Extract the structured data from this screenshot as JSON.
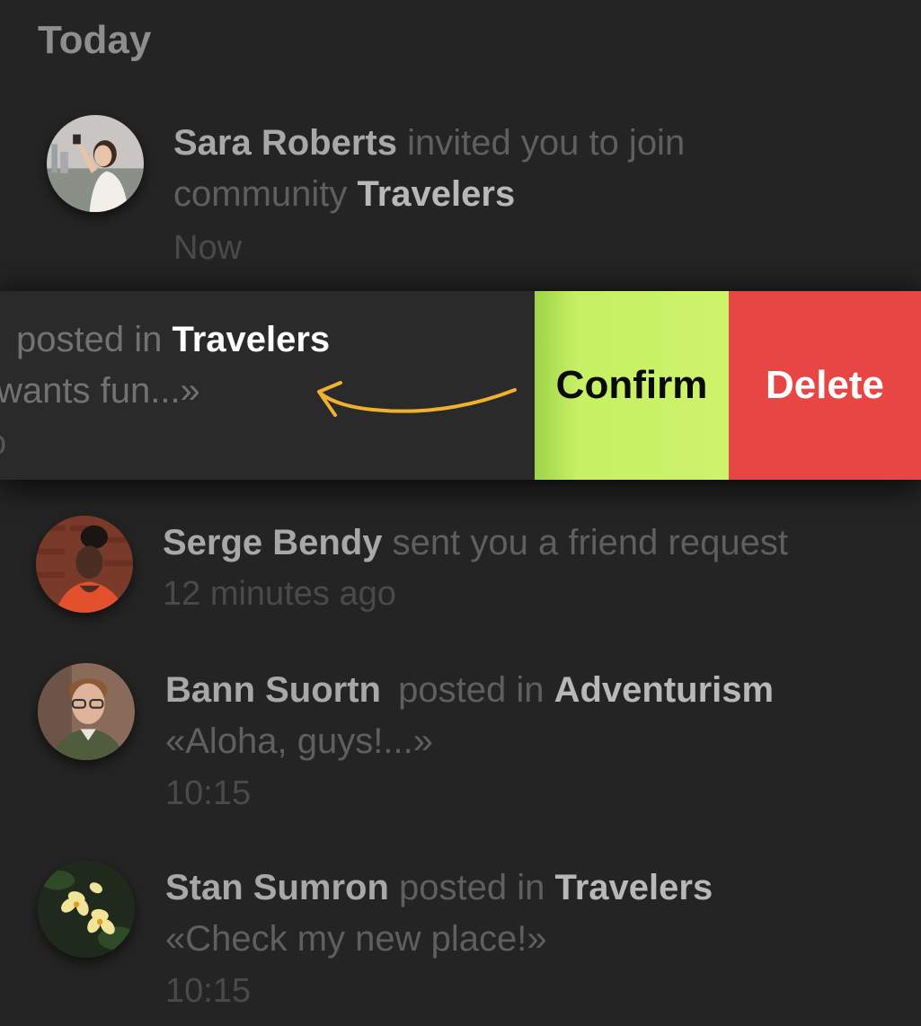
{
  "section": {
    "title": "Today"
  },
  "notifications": [
    {
      "name": "Sara Roberts",
      "action": "invited you to join",
      "line2_prefix": "community",
      "target": "Travelers",
      "time": "Now"
    },
    {
      "action": "posted in",
      "target": "Travelers",
      "quote": "wants fun...»",
      "time": "o"
    },
    {
      "name": "Serge Bendy",
      "action": "sent you a friend request",
      "time": "12 minutes ago"
    },
    {
      "name": "Bann Suortn",
      "action": "posted in",
      "target": "Adventurism",
      "quote": "«Aloha, guys!...»",
      "time": "10:15"
    },
    {
      "name": "Stan Sumron",
      "action": "posted in",
      "target": "Travelers",
      "quote": "«Check my new place!»",
      "time": "10:15"
    }
  ],
  "swipe_actions": {
    "confirm_label": "Confirm",
    "delete_label": "Delete"
  },
  "colors": {
    "background": "#242424",
    "confirm": "#c7f064",
    "delete": "#e84545",
    "arrow": "#f0b030"
  }
}
